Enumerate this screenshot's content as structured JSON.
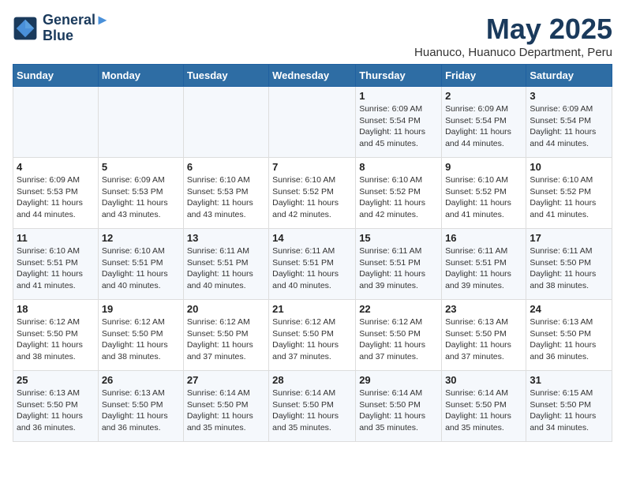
{
  "logo": {
    "line1": "General",
    "line2": "Blue"
  },
  "title": "May 2025",
  "location": "Huanuco, Huanuco Department, Peru",
  "days_of_week": [
    "Sunday",
    "Monday",
    "Tuesday",
    "Wednesday",
    "Thursday",
    "Friday",
    "Saturday"
  ],
  "weeks": [
    [
      {
        "day": "",
        "detail": ""
      },
      {
        "day": "",
        "detail": ""
      },
      {
        "day": "",
        "detail": ""
      },
      {
        "day": "",
        "detail": ""
      },
      {
        "day": "1",
        "detail": "Sunrise: 6:09 AM\nSunset: 5:54 PM\nDaylight: 11 hours\nand 45 minutes."
      },
      {
        "day": "2",
        "detail": "Sunrise: 6:09 AM\nSunset: 5:54 PM\nDaylight: 11 hours\nand 44 minutes."
      },
      {
        "day": "3",
        "detail": "Sunrise: 6:09 AM\nSunset: 5:54 PM\nDaylight: 11 hours\nand 44 minutes."
      }
    ],
    [
      {
        "day": "4",
        "detail": "Sunrise: 6:09 AM\nSunset: 5:53 PM\nDaylight: 11 hours\nand 44 minutes."
      },
      {
        "day": "5",
        "detail": "Sunrise: 6:09 AM\nSunset: 5:53 PM\nDaylight: 11 hours\nand 43 minutes."
      },
      {
        "day": "6",
        "detail": "Sunrise: 6:10 AM\nSunset: 5:53 PM\nDaylight: 11 hours\nand 43 minutes."
      },
      {
        "day": "7",
        "detail": "Sunrise: 6:10 AM\nSunset: 5:52 PM\nDaylight: 11 hours\nand 42 minutes."
      },
      {
        "day": "8",
        "detail": "Sunrise: 6:10 AM\nSunset: 5:52 PM\nDaylight: 11 hours\nand 42 minutes."
      },
      {
        "day": "9",
        "detail": "Sunrise: 6:10 AM\nSunset: 5:52 PM\nDaylight: 11 hours\nand 41 minutes."
      },
      {
        "day": "10",
        "detail": "Sunrise: 6:10 AM\nSunset: 5:52 PM\nDaylight: 11 hours\nand 41 minutes."
      }
    ],
    [
      {
        "day": "11",
        "detail": "Sunrise: 6:10 AM\nSunset: 5:51 PM\nDaylight: 11 hours\nand 41 minutes."
      },
      {
        "day": "12",
        "detail": "Sunrise: 6:10 AM\nSunset: 5:51 PM\nDaylight: 11 hours\nand 40 minutes."
      },
      {
        "day": "13",
        "detail": "Sunrise: 6:11 AM\nSunset: 5:51 PM\nDaylight: 11 hours\nand 40 minutes."
      },
      {
        "day": "14",
        "detail": "Sunrise: 6:11 AM\nSunset: 5:51 PM\nDaylight: 11 hours\nand 40 minutes."
      },
      {
        "day": "15",
        "detail": "Sunrise: 6:11 AM\nSunset: 5:51 PM\nDaylight: 11 hours\nand 39 minutes."
      },
      {
        "day": "16",
        "detail": "Sunrise: 6:11 AM\nSunset: 5:51 PM\nDaylight: 11 hours\nand 39 minutes."
      },
      {
        "day": "17",
        "detail": "Sunrise: 6:11 AM\nSunset: 5:50 PM\nDaylight: 11 hours\nand 38 minutes."
      }
    ],
    [
      {
        "day": "18",
        "detail": "Sunrise: 6:12 AM\nSunset: 5:50 PM\nDaylight: 11 hours\nand 38 minutes."
      },
      {
        "day": "19",
        "detail": "Sunrise: 6:12 AM\nSunset: 5:50 PM\nDaylight: 11 hours\nand 38 minutes."
      },
      {
        "day": "20",
        "detail": "Sunrise: 6:12 AM\nSunset: 5:50 PM\nDaylight: 11 hours\nand 37 minutes."
      },
      {
        "day": "21",
        "detail": "Sunrise: 6:12 AM\nSunset: 5:50 PM\nDaylight: 11 hours\nand 37 minutes."
      },
      {
        "day": "22",
        "detail": "Sunrise: 6:12 AM\nSunset: 5:50 PM\nDaylight: 11 hours\nand 37 minutes."
      },
      {
        "day": "23",
        "detail": "Sunrise: 6:13 AM\nSunset: 5:50 PM\nDaylight: 11 hours\nand 37 minutes."
      },
      {
        "day": "24",
        "detail": "Sunrise: 6:13 AM\nSunset: 5:50 PM\nDaylight: 11 hours\nand 36 minutes."
      }
    ],
    [
      {
        "day": "25",
        "detail": "Sunrise: 6:13 AM\nSunset: 5:50 PM\nDaylight: 11 hours\nand 36 minutes."
      },
      {
        "day": "26",
        "detail": "Sunrise: 6:13 AM\nSunset: 5:50 PM\nDaylight: 11 hours\nand 36 minutes."
      },
      {
        "day": "27",
        "detail": "Sunrise: 6:14 AM\nSunset: 5:50 PM\nDaylight: 11 hours\nand 35 minutes."
      },
      {
        "day": "28",
        "detail": "Sunrise: 6:14 AM\nSunset: 5:50 PM\nDaylight: 11 hours\nand 35 minutes."
      },
      {
        "day": "29",
        "detail": "Sunrise: 6:14 AM\nSunset: 5:50 PM\nDaylight: 11 hours\nand 35 minutes."
      },
      {
        "day": "30",
        "detail": "Sunrise: 6:14 AM\nSunset: 5:50 PM\nDaylight: 11 hours\nand 35 minutes."
      },
      {
        "day": "31",
        "detail": "Sunrise: 6:15 AM\nSunset: 5:50 PM\nDaylight: 11 hours\nand 34 minutes."
      }
    ]
  ]
}
